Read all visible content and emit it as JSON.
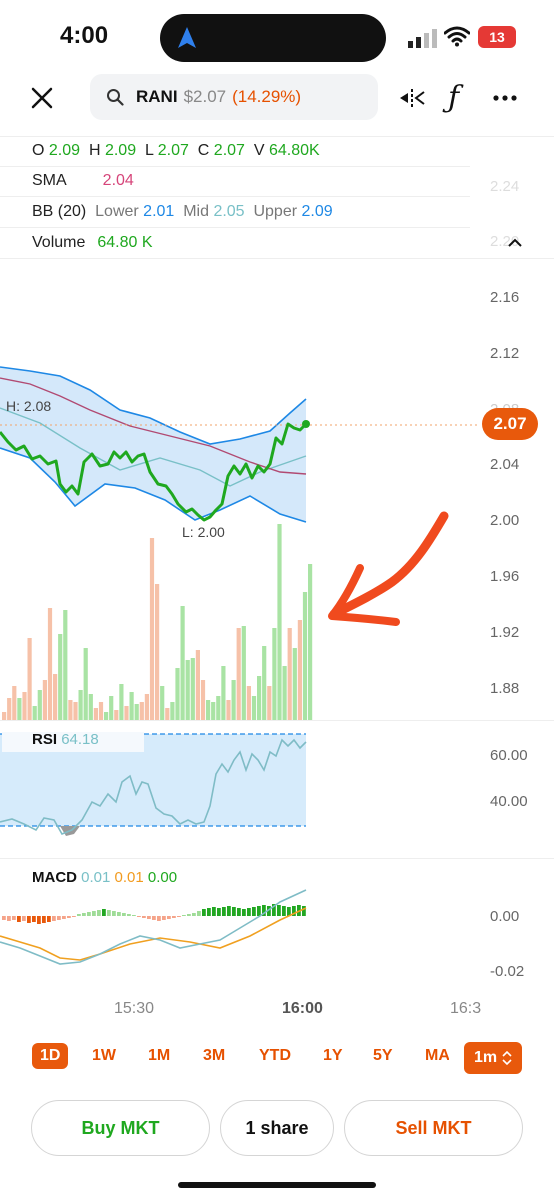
{
  "status_bar": {
    "time": "4:00",
    "battery": "13"
  },
  "header": {
    "symbol": "RANI",
    "price": "$2.07",
    "change": "(14.29%)"
  },
  "ohlcv": {
    "o_label": "O",
    "o": "2.09",
    "h_label": "H",
    "h": "2.09",
    "l_label": "L",
    "l": "2.07",
    "c_label": "C",
    "c": "2.07",
    "v_label": "V",
    "v": "64.80K"
  },
  "sma": {
    "label": "SMA",
    "value": "2.04"
  },
  "bb": {
    "label": "BB (20)",
    "lower_label": "Lower",
    "lower": "2.01",
    "mid_label": "Mid",
    "mid": "2.05",
    "upper_label": "Upper",
    "upper": "2.09"
  },
  "volume": {
    "label": "Volume",
    "value": "64.80 K"
  },
  "price_axis": [
    "2.24",
    "2.20",
    "2.16",
    "2.12",
    "2.08",
    "2.04",
    "2.00",
    "1.96",
    "1.92",
    "1.88"
  ],
  "price_tag": "2.07",
  "hi_label": "H: 2.08",
  "lo_label": "L: 2.00",
  "rsi": {
    "label": "RSI",
    "value": "64.18",
    "axis": [
      "60.00",
      "40.00"
    ]
  },
  "macd": {
    "label": "MACD",
    "v1": "0.01",
    "v2": "0.01",
    "v3": "0.00",
    "axis": [
      "0.00",
      "-0.02"
    ]
  },
  "time_axis": [
    "15:30",
    "16:00",
    "16:3"
  ],
  "ranges": [
    "1D",
    "1W",
    "1M",
    "3M",
    "YTD",
    "1Y",
    "5Y",
    "MA"
  ],
  "interval": "1m",
  "actions": {
    "buy": "Buy MKT",
    "qty": "1 share",
    "sell": "Sell MKT"
  },
  "colors": {
    "accent": "#e8590c",
    "up": "#1fa81f",
    "bb_band": "#1e88e5"
  }
}
